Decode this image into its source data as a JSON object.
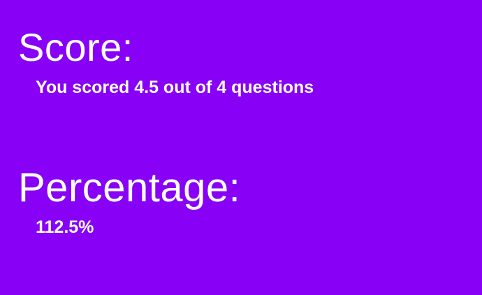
{
  "colors": {
    "background": "#8800F5",
    "text": "#FFFFFF"
  },
  "score": {
    "heading": "Score:",
    "summary": "You scored 4.5 out of 4 questions"
  },
  "percentage": {
    "heading": "Percentage:",
    "value": "112.5%"
  }
}
